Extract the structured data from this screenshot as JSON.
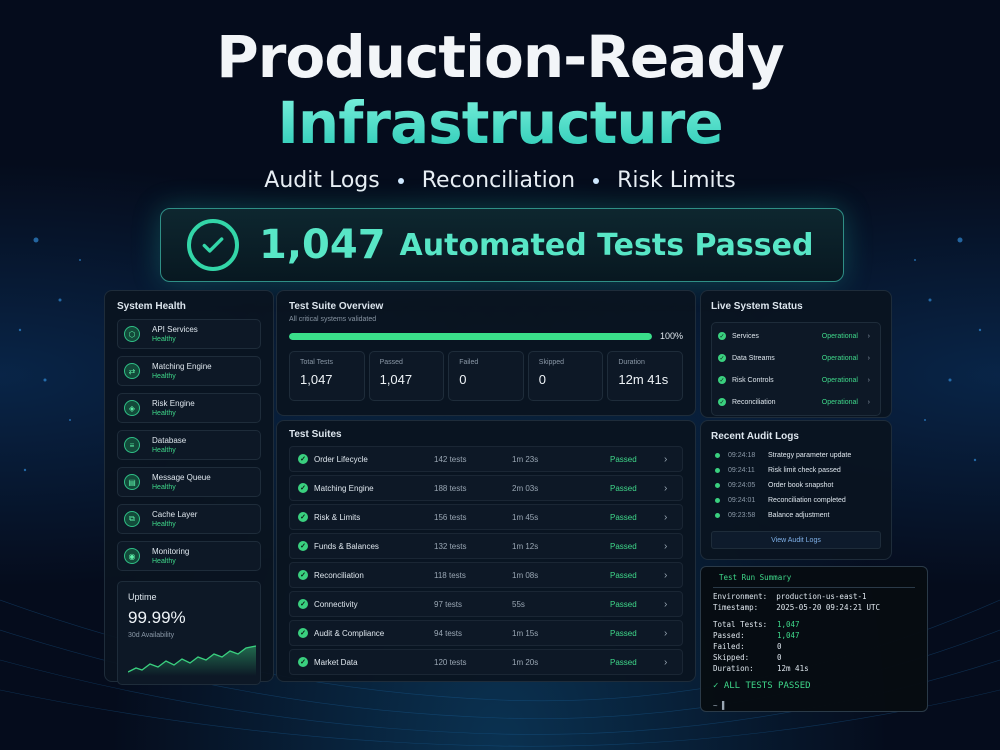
{
  "hero": {
    "line1": "Production-Ready",
    "line2": "Infrastructure",
    "features": [
      "Audit Logs",
      "Reconciliation",
      "Risk Limits"
    ]
  },
  "banner": {
    "count": "1,047",
    "text": "Automated Tests Passed"
  },
  "system_health": {
    "title": "System Health",
    "items": [
      {
        "name": "API Services",
        "status": "Healthy",
        "icon": "api-icon"
      },
      {
        "name": "Matching Engine",
        "status": "Healthy",
        "icon": "matching-icon"
      },
      {
        "name": "Risk Engine",
        "status": "Healthy",
        "icon": "risk-icon"
      },
      {
        "name": "Database",
        "status": "Healthy",
        "icon": "database-icon"
      },
      {
        "name": "Message Queue",
        "status": "Healthy",
        "icon": "queue-icon"
      },
      {
        "name": "Cache Layer",
        "status": "Healthy",
        "icon": "cache-icon"
      },
      {
        "name": "Monitoring",
        "status": "Healthy",
        "icon": "monitoring-icon"
      }
    ],
    "uptime": {
      "label": "Uptime",
      "value": "99.99%",
      "sub": "30d Availability"
    }
  },
  "overview": {
    "title": "Test Suite Overview",
    "subtitle": "All critical systems validated",
    "progress": 1.0,
    "progress_label": "100%",
    "stats": [
      {
        "label": "Total Tests",
        "value": "1,047"
      },
      {
        "label": "Passed",
        "value": "1,047"
      },
      {
        "label": "Failed",
        "value": "0"
      },
      {
        "label": "Skipped",
        "value": "0"
      },
      {
        "label": "Duration",
        "value": "12m 41s"
      }
    ]
  },
  "suites": {
    "title": "Test Suites",
    "rows": [
      {
        "name": "Order Lifecycle",
        "tests": "142 tests",
        "duration": "1m 23s",
        "status": "Passed"
      },
      {
        "name": "Matching Engine",
        "tests": "188 tests",
        "duration": "2m 03s",
        "status": "Passed"
      },
      {
        "name": "Risk & Limits",
        "tests": "156 tests",
        "duration": "1m 45s",
        "status": "Passed"
      },
      {
        "name": "Funds & Balances",
        "tests": "132 tests",
        "duration": "1m 12s",
        "status": "Passed"
      },
      {
        "name": "Reconciliation",
        "tests": "118 tests",
        "duration": "1m 08s",
        "status": "Passed"
      },
      {
        "name": "Connectivity",
        "tests": "97 tests",
        "duration": "55s",
        "status": "Passed"
      },
      {
        "name": "Audit & Compliance",
        "tests": "94 tests",
        "duration": "1m 15s",
        "status": "Passed"
      },
      {
        "name": "Market Data",
        "tests": "120 tests",
        "duration": "1m 20s",
        "status": "Passed"
      }
    ]
  },
  "live": {
    "title": "Live System Status",
    "rows": [
      {
        "name": "Services",
        "status": "Operational"
      },
      {
        "name": "Data Streams",
        "status": "Operational"
      },
      {
        "name": "Risk Controls",
        "status": "Operational"
      },
      {
        "name": "Reconciliation",
        "status": "Operational"
      }
    ]
  },
  "audit": {
    "title": "Recent Audit Logs",
    "rows": [
      {
        "time": "09:24:18",
        "message": "Strategy parameter update"
      },
      {
        "time": "09:24:11",
        "message": "Risk limit check passed"
      },
      {
        "time": "09:24:05",
        "message": "Order book snapshot"
      },
      {
        "time": "09:24:01",
        "message": "Reconciliation completed"
      },
      {
        "time": "09:23:58",
        "message": "Balance adjustment"
      }
    ],
    "button": "View Audit Logs"
  },
  "terminal": {
    "title": "Test Run Summary",
    "env_label": "Environment:",
    "env_value": "production-us-east-1",
    "ts_label": "Timestamp:",
    "ts_value": "2025-05-20 09:24:21 UTC",
    "summary": [
      {
        "label": "Total Tests:",
        "value": "1,047"
      },
      {
        "label": "Passed:",
        "value": "1,047"
      },
      {
        "label": "Failed:",
        "value": "0"
      },
      {
        "label": "Skipped:",
        "value": "0"
      },
      {
        "label": "Duration:",
        "value": "12m 41s"
      }
    ],
    "result": "ALL TESTS PASSED",
    "prompt": "~ ▌"
  },
  "colors": {
    "accent": "#4fe0c8",
    "success": "#3ad07f",
    "background": "#050c1c"
  }
}
